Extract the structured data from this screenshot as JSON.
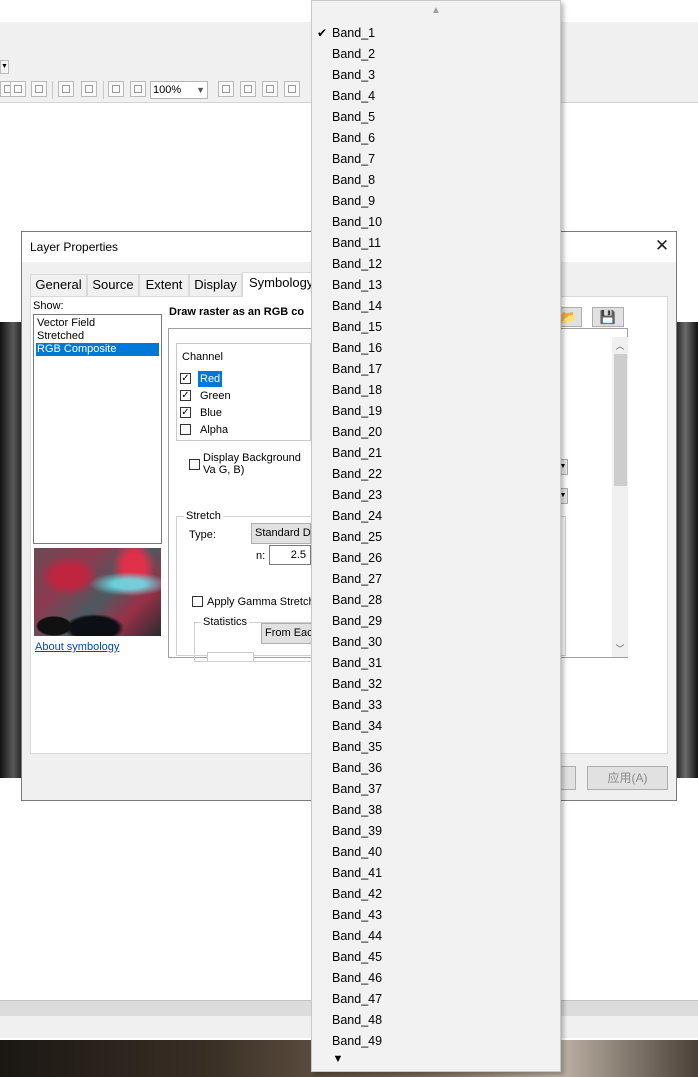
{
  "toolbar": {
    "zoom": "100%"
  },
  "dialog": {
    "title": "Layer Properties",
    "close_glyph": "✕",
    "tabs": [
      "General",
      "Source",
      "Extent",
      "Display",
      "Symbology"
    ],
    "show_label": "Show:",
    "show_items": [
      "Vector Field",
      "Stretched",
      "RGB Composite"
    ],
    "selected_show_item": "RGB Composite",
    "about_link": "About symbology",
    "draw_label": "Draw raster as an RGB co",
    "channel_header": "Channel",
    "channels": [
      {
        "label": "Red",
        "checked": true,
        "selected": true
      },
      {
        "label": "Green",
        "checked": true,
        "selected": false
      },
      {
        "label": "Blue",
        "checked": true,
        "selected": false
      },
      {
        "label": "Alpha",
        "checked": false,
        "selected": false
      }
    ],
    "display_bg_label": "Display Background Va G, B)",
    "stretch_label": "Stretch",
    "type_label": "Type:",
    "type_value": "Standard De",
    "n_label": "n:",
    "n_value": "2.5",
    "gamma_label": "Apply Gamma Stretch:",
    "statistics_label": "Statistics",
    "statistics_value": "From Each",
    "apply_button": "应用(A)"
  },
  "band_dropdown": {
    "selected": "Band_1",
    "check_glyph": "✔",
    "up_glyph": "▲",
    "down_glyph": "▼",
    "items": [
      "Band_1",
      "Band_2",
      "Band_3",
      "Band_4",
      "Band_5",
      "Band_6",
      "Band_7",
      "Band_8",
      "Band_9",
      "Band_10",
      "Band_11",
      "Band_12",
      "Band_13",
      "Band_14",
      "Band_15",
      "Band_16",
      "Band_17",
      "Band_18",
      "Band_19",
      "Band_20",
      "Band_21",
      "Band_22",
      "Band_23",
      "Band_24",
      "Band_25",
      "Band_26",
      "Band_27",
      "Band_28",
      "Band_29",
      "Band_30",
      "Band_31",
      "Band_32",
      "Band_33",
      "Band_34",
      "Band_35",
      "Band_36",
      "Band_37",
      "Band_38",
      "Band_39",
      "Band_40",
      "Band_41",
      "Band_42",
      "Band_43",
      "Band_44",
      "Band_45",
      "Band_46",
      "Band_47",
      "Band_48",
      "Band_49"
    ]
  },
  "colors": {
    "selection": "#0078d7",
    "link": "#0645ad",
    "dialog_bg": "#f0f0f0"
  }
}
